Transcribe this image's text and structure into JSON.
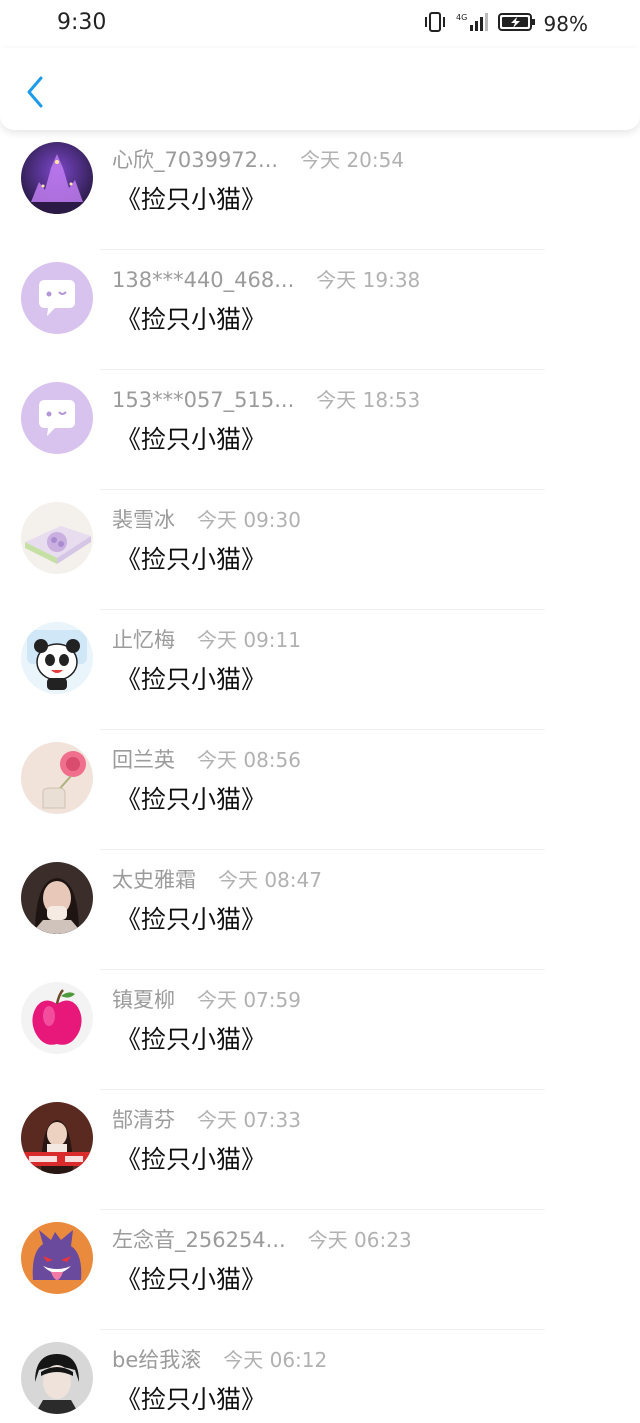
{
  "status_bar": {
    "time": "9:30",
    "battery": "98%"
  },
  "nav": {
    "back_icon": "chevron-left-icon",
    "accent": "#1e9be8"
  },
  "messages": [
    {
      "name": "心欣_7039972...",
      "time": "今天 20:54",
      "text": "《捡只小猫》",
      "avatar": "castle-night-photo"
    },
    {
      "name": "138***440_468...",
      "time": "今天 19:38",
      "text": "《捡只小猫》",
      "avatar": "default-chat-avatar"
    },
    {
      "name": "153***057_515...",
      "time": "今天 18:53",
      "text": "《捡只小猫》",
      "avatar": "default-chat-avatar"
    },
    {
      "name": "裴雪冰",
      "time": "今天 09:30",
      "text": "《捡只小猫》",
      "avatar": "flower-box-photo"
    },
    {
      "name": "止忆梅",
      "time": "今天 09:11",
      "text": "《捡只小猫》",
      "avatar": "panda-cartoon"
    },
    {
      "name": "回兰英",
      "time": "今天 08:56",
      "text": "《捡只小猫》",
      "avatar": "pink-flower-photo"
    },
    {
      "name": "太史雅霜",
      "time": "今天 08:47",
      "text": "《捡只小猫》",
      "avatar": "girl-portrait-photo"
    },
    {
      "name": "镇夏柳",
      "time": "今天 07:59",
      "text": "《捡只小猫》",
      "avatar": "pink-apple-photo"
    },
    {
      "name": "郜清芬",
      "time": "今天 07:33",
      "text": "《捡只小猫》",
      "avatar": "girl-banner-photo"
    },
    {
      "name": "左念音_256254...",
      "time": "今天 06:23",
      "text": "《捡只小猫》",
      "avatar": "purple-ghost-cartoon"
    },
    {
      "name": "be给我滚",
      "time": "今天 06:12",
      "text": "《捡只小猫》",
      "avatar": "boy-portrait-photo"
    }
  ]
}
